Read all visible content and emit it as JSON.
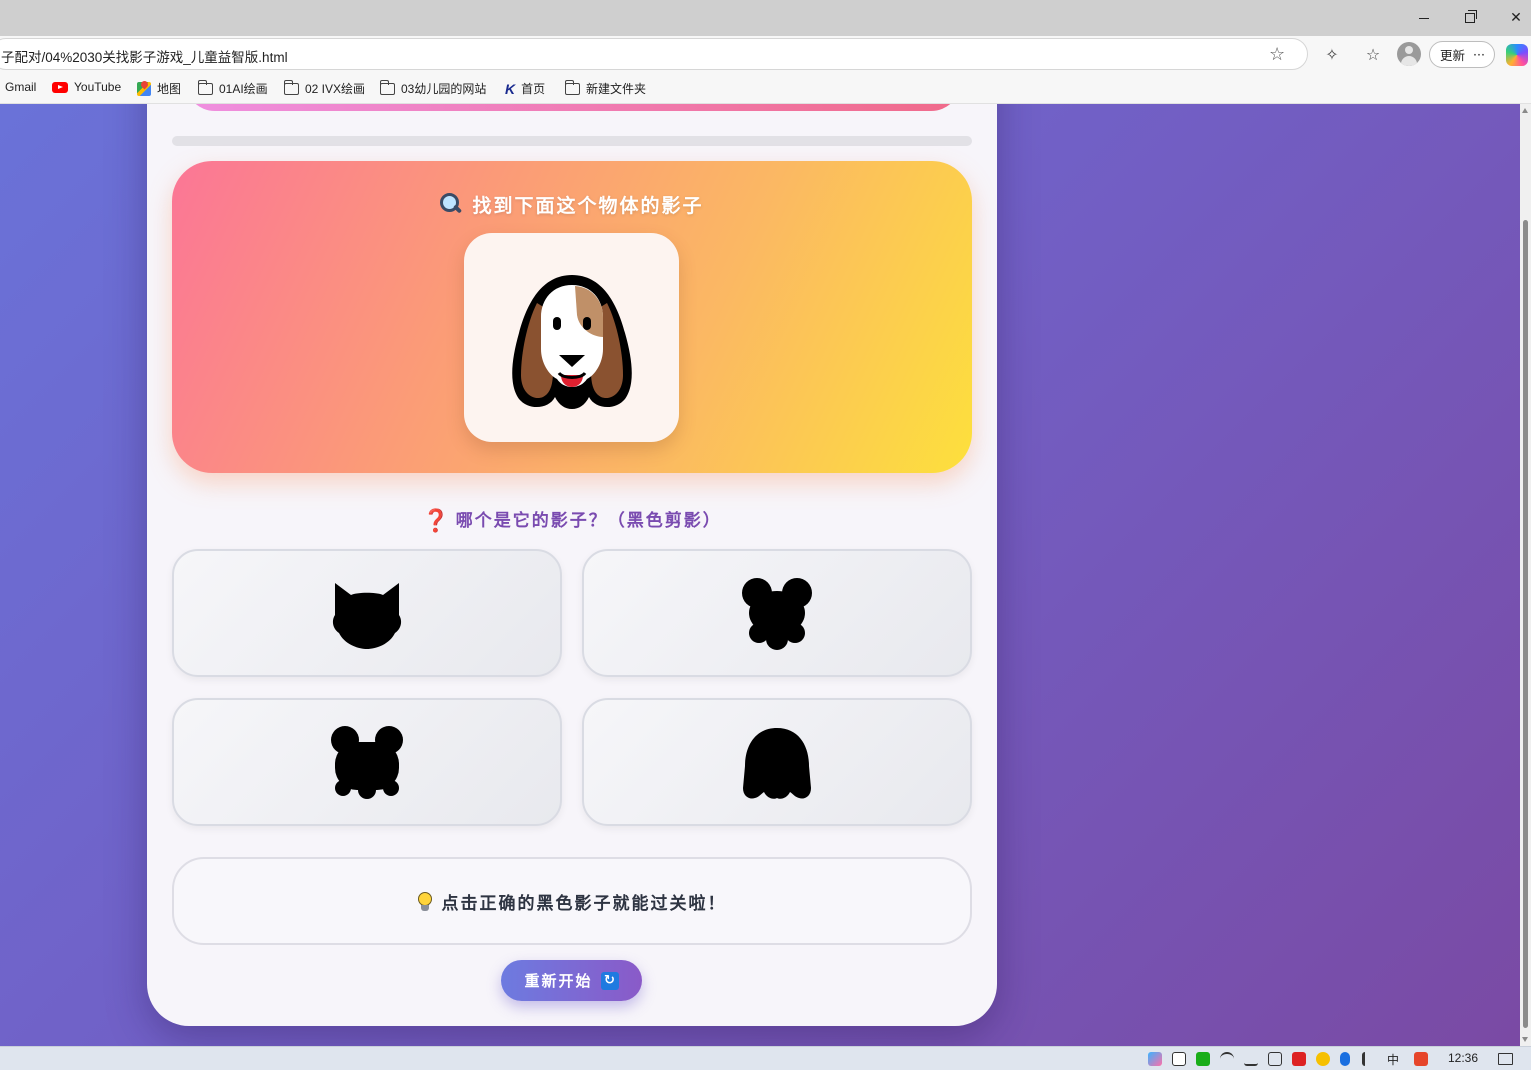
{
  "browser": {
    "address": "子配对/04%2030关找影子游戏_儿童益智版.html",
    "update_label": "更新",
    "more_label": "···",
    "bookmarks": [
      {
        "label": "Gmail"
      },
      {
        "label": "YouTube"
      },
      {
        "label": "地图"
      },
      {
        "label": "01AI绘画"
      },
      {
        "label": "02 IVX绘画"
      },
      {
        "label": "03幼儿园的网站"
      },
      {
        "label": "首页"
      },
      {
        "label": "新建文件夹"
      }
    ]
  },
  "game": {
    "progress_fraction": 0.0,
    "target_title": "找到下面这个物体的影子",
    "target_icon": "dog-face-icon",
    "question": "哪个是它的影子？（黑色剪影）",
    "options": [
      {
        "icon": "cat-silhouette-icon"
      },
      {
        "icon": "bear-silhouette-icon"
      },
      {
        "icon": "frog-silhouette-icon"
      },
      {
        "icon": "ghost-silhouette-icon"
      }
    ],
    "hint": "点击正确的黑色影子就能过关啦！",
    "restart_label": "重新开始"
  },
  "taskbar": {
    "time": "12:36",
    "ime": "中"
  },
  "colors": {
    "page_bg_start": "#6a72d8",
    "page_bg_end": "#7a4aa4",
    "panel_start": "#fb7696",
    "panel_end": "#fde03c",
    "question_color": "#7a4bb0"
  }
}
